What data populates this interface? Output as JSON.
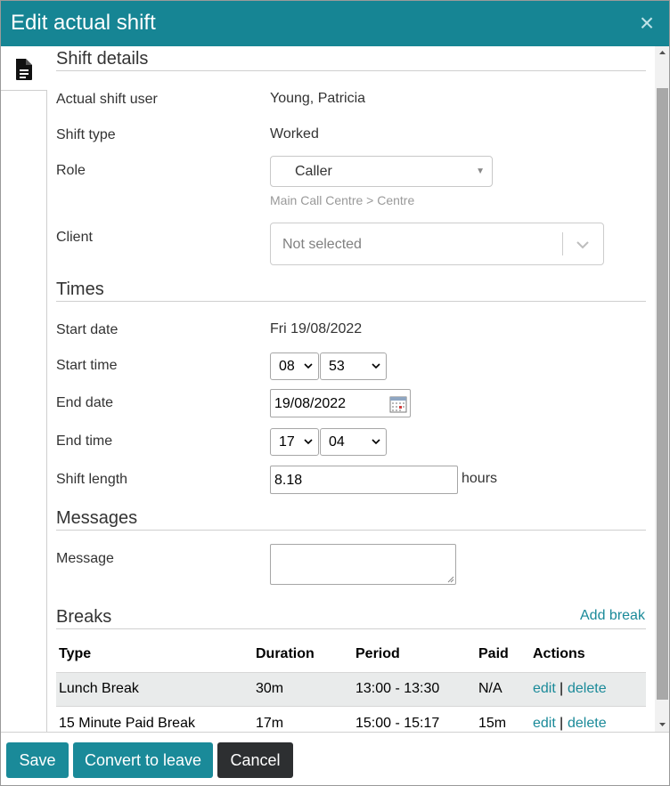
{
  "dialog": {
    "title": "Edit actual shift",
    "close_label": "×"
  },
  "sections": {
    "shift_details": "Shift details",
    "times": "Times",
    "messages": "Messages",
    "breaks": "Breaks"
  },
  "shift_details": {
    "user_label": "Actual shift user",
    "user_value": "Young, Patricia",
    "type_label": "Shift type",
    "type_value": "Worked",
    "role_label": "Role",
    "role_value": "Caller",
    "role_hint": "Main Call Centre > Centre",
    "client_label": "Client",
    "client_placeholder": "Not selected"
  },
  "times": {
    "start_date_label": "Start date",
    "start_date_value": "Fri 19/08/2022",
    "start_time_label": "Start time",
    "start_hour": "08",
    "start_minute": "53",
    "end_date_label": "End date",
    "end_date_value": "19/08/2022",
    "end_time_label": "End time",
    "end_hour": "17",
    "end_minute": "04",
    "length_label": "Shift length",
    "length_value": "8.18",
    "length_unit": "hours"
  },
  "messages": {
    "message_label": "Message",
    "message_value": ""
  },
  "breaks": {
    "add_label": "Add break",
    "columns": [
      "Type",
      "Duration",
      "Period",
      "Paid",
      "Actions"
    ],
    "rows": [
      {
        "type": "Lunch Break",
        "duration": "30m",
        "period": "13:00 - 13:30",
        "paid": "N/A",
        "edit": "edit",
        "sep": "|",
        "delete": "delete"
      },
      {
        "type": "15 Minute Paid Break",
        "duration": "17m",
        "period": "15:00 - 15:17",
        "paid": "15m",
        "edit": "edit",
        "sep": "|",
        "delete": "delete"
      }
    ]
  },
  "footer": {
    "save": "Save",
    "convert": "Convert to leave",
    "cancel": "Cancel"
  },
  "colors": {
    "accent": "#1a8a99",
    "titlebar": "#168594",
    "cancel": "#2d2f31",
    "alt_row": "#e9ebeb"
  }
}
